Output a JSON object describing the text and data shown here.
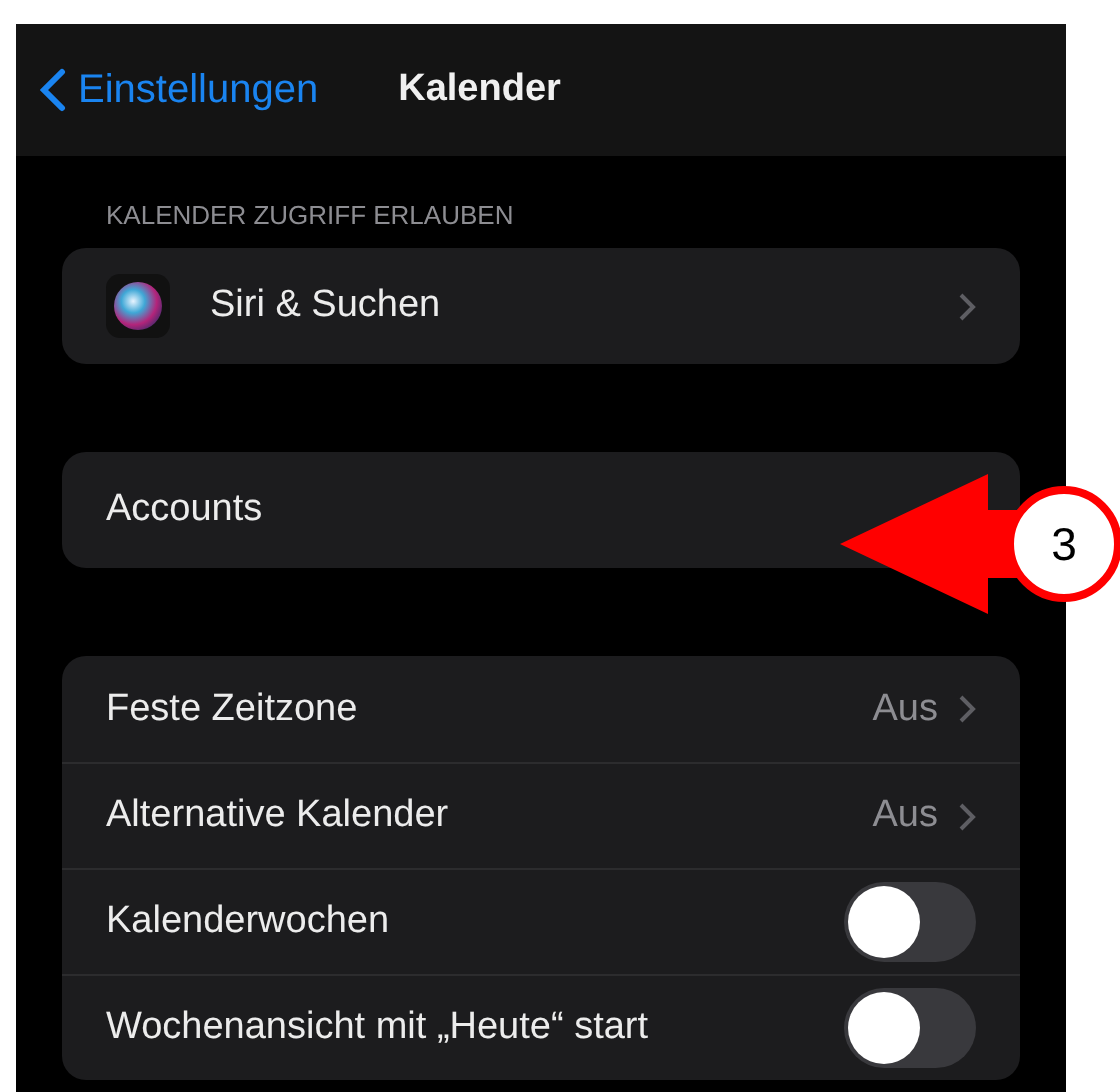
{
  "nav": {
    "back": "Einstellungen",
    "title": "Kalender"
  },
  "sections": [
    {
      "header": "KALENDER ZUGRIFF ERLAUBEN",
      "items": [
        {
          "kind": "app",
          "label": "Siri & Suchen"
        }
      ]
    },
    {
      "items": [
        {
          "kind": "plain",
          "label": "Accounts"
        }
      ]
    },
    {
      "items": [
        {
          "kind": "value",
          "label": "Feste Zeitzone",
          "value": "Aus"
        },
        {
          "kind": "value",
          "label": "Alternative Kalender",
          "value": "Aus"
        },
        {
          "kind": "toggle",
          "label": "Kalenderwochen",
          "on": false
        },
        {
          "kind": "toggle",
          "label": "Wochenansicht mit „Heute“ start",
          "on": false
        }
      ]
    }
  ],
  "annotation": {
    "number": "3"
  }
}
